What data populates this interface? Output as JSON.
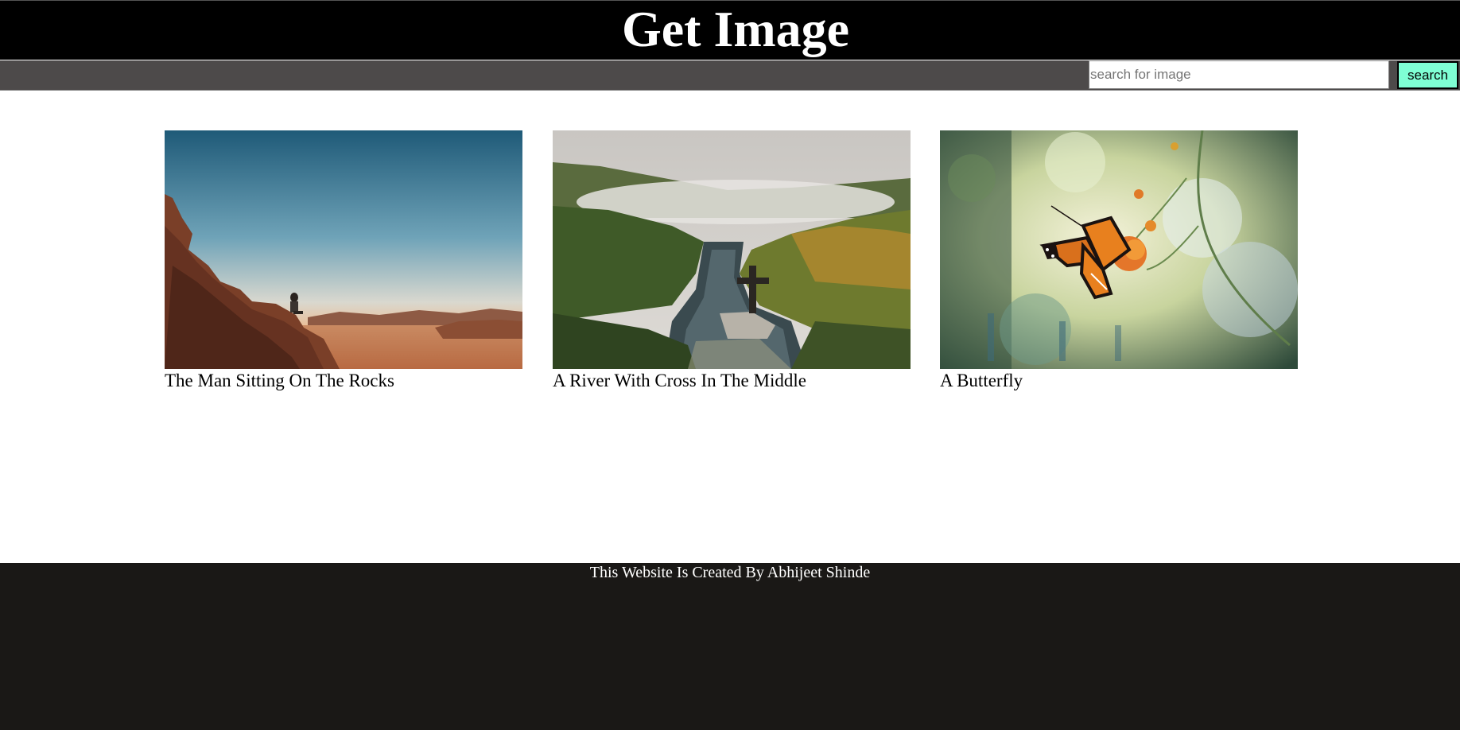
{
  "header": {
    "title": "Get Image"
  },
  "search": {
    "placeholder": "search for image",
    "value": "",
    "button_label": "search"
  },
  "gallery": {
    "items": [
      {
        "caption": "The Man Sitting On The Rocks",
        "image": "desert-sunset-man-on-rocks"
      },
      {
        "caption": "A River With Cross In The Middle",
        "image": "misty-river-with-cross"
      },
      {
        "caption": "A Butterfly",
        "image": "butterfly-on-orange-flower"
      }
    ]
  },
  "footer": {
    "text": "This Website Is Created By Abhijeet Shinde"
  },
  "colors": {
    "header_bg": "#000000",
    "search_bar_bg": "#4d4a4a",
    "search_button_bg": "#7fffd4",
    "footer_bg": "#1a1816"
  }
}
